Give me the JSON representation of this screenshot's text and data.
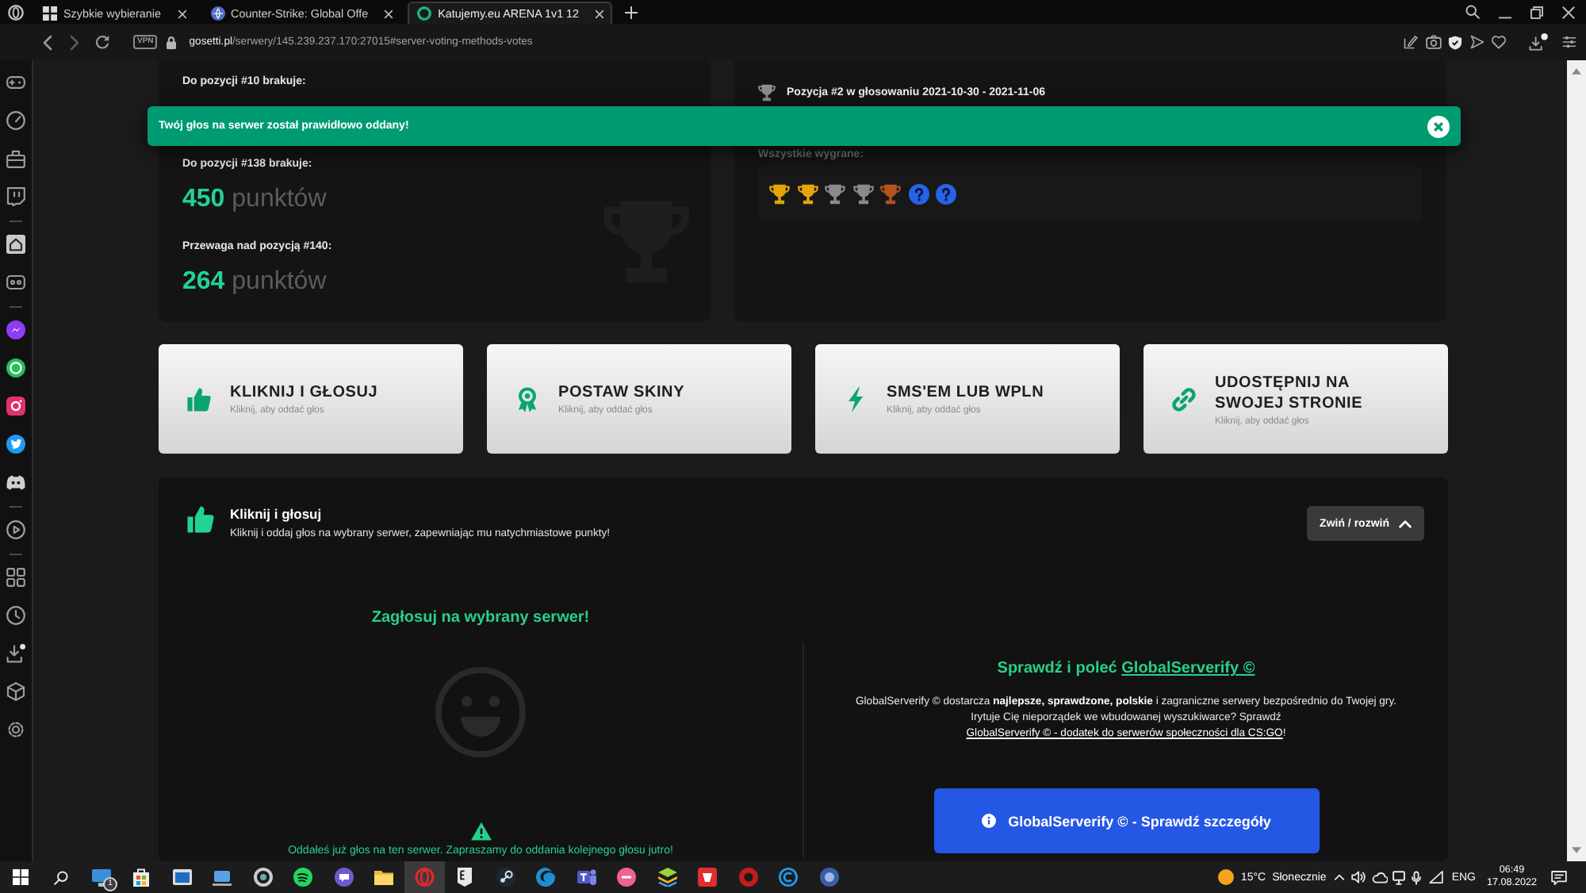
{
  "browser": {
    "tabs": [
      {
        "title": "Szybkie wybieranie",
        "selected": false
      },
      {
        "title": "Counter-Strike: Global Offe",
        "selected": false
      },
      {
        "title": "Katujemy.eu ARENA 1v1 12",
        "selected": true
      }
    ],
    "vpn": "VPN",
    "url": {
      "host": "gosetti.pl",
      "path": "/serwery/145.239.237.170:27015#server-voting-methods-votes"
    }
  },
  "sidebar": {
    "items": [
      {
        "selected": false
      },
      {
        "selected": false
      },
      {
        "selected": false
      },
      {
        "selected": false
      },
      {
        "selected": true
      },
      {
        "selected": false
      },
      {
        "selected": false
      },
      {
        "selected": false
      },
      {
        "selected": false
      },
      {
        "selected": false
      },
      {
        "selected": false
      },
      {
        "selected": false
      },
      {
        "selected": false
      },
      {
        "selected": false
      },
      {
        "selected": false
      },
      {
        "selected": false
      },
      {
        "selected": false
      }
    ]
  },
  "ranking": {
    "stats": [
      {
        "label": "Do pozycji #10 brakuje:"
      },
      {
        "label": "Do pozycji #138 brakuje:",
        "value": "450",
        "unit": "punktów"
      },
      {
        "label": "Przewaga nad pozycją #140:",
        "value": "264",
        "unit": "punktów"
      }
    ]
  },
  "awards": {
    "heading": "Pozycja #2 w głosowaniu 2021-10-30 - 2021-11-06",
    "label": "Wszystkie wygrane:",
    "items": [
      {
        "kind": "trophy",
        "color": "#e5a50a"
      },
      {
        "kind": "trophy",
        "color": "#e5a50a"
      },
      {
        "kind": "trophy",
        "color": "#8a8a8a"
      },
      {
        "kind": "trophy",
        "color": "#8a8a8a"
      },
      {
        "kind": "trophy",
        "color": "#b4531e"
      },
      {
        "kind": "unknown",
        "color": "#2563eb"
      },
      {
        "kind": "unknown",
        "color": "#2563eb"
      }
    ]
  },
  "toast": {
    "message": "Twój głos na serwer został prawidłowo oddany!"
  },
  "methods": [
    {
      "title": "KLIKNIJ I GŁOSUJ",
      "subtitle": "Kliknij, aby oddać głos"
    },
    {
      "title": "POSTAW SKINY",
      "subtitle": "Kliknij, aby oddać głos"
    },
    {
      "title": "SMS'EM LUB WPLN",
      "subtitle": "Kliknij, aby oddać głos"
    },
    {
      "title": "UDOSTĘPNIJ NA SWOJEJ STRONIE",
      "subtitle": "Kliknij, aby oddać głos"
    }
  ],
  "vote_panel": {
    "title": "Kliknij i głosuj",
    "subtitle": "Kliknij i oddaj głos na wybrany serwer, zapewniając mu natychmiastowe punkty!",
    "toggle": {
      "label": "Zwiń / rozwiń",
      "expanded": true
    },
    "vote": {
      "heading": "Zagłosuj na wybrany serwer!",
      "notice": "Oddałeś już głos na ten serwer. Zapraszamy do oddania kolejnego głosu jutro!"
    },
    "promo": {
      "heading": "Sprawdź i poleć",
      "heading_link": "GlobalServerify ©",
      "text": "GlobalServerify © dostarcza **najlepsze, sprawdzone, polskie** i zagraniczne serwery bezpośrednio do Twojej gry. Irytuje Cię nieporządek we wbudowanej wyszukiwarce? Sprawdź",
      "link": "GlobalServerify © - dodatek do serwerów społeczności dla CS:GO",
      "after": "!",
      "button": "GlobalServerify © - Sprawdź szczegóły"
    }
  },
  "taskbar": {
    "apps": [
      {
        "selected": false,
        "badge": "1"
      },
      {
        "selected": false
      },
      {
        "selected": false
      },
      {
        "selected": false
      },
      {
        "selected": false
      },
      {
        "selected": false
      },
      {
        "selected": false
      },
      {
        "selected": false
      },
      {
        "selected": true
      },
      {
        "selected": false
      },
      {
        "selected": false
      },
      {
        "selected": false
      },
      {
        "selected": false
      },
      {
        "selected": false
      },
      {
        "selected": false
      },
      {
        "selected": false
      },
      {
        "selected": false
      },
      {
        "selected": false
      },
      {
        "selected": false
      }
    ],
    "weather": {
      "temperature": "15°C",
      "condition": "Słonecznie"
    },
    "language": "ENG",
    "time": "06:49",
    "date": "17.08.2022"
  }
}
